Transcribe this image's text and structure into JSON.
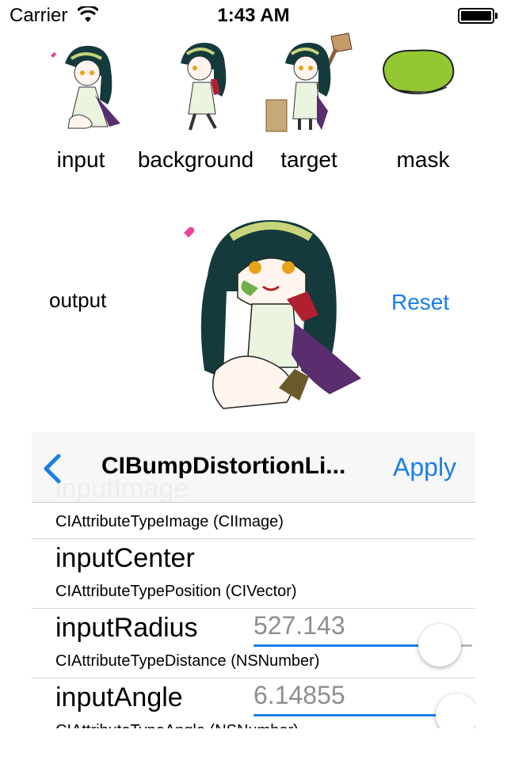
{
  "status_bar": {
    "carrier": "Carrier",
    "time": "1:43 AM",
    "battery_level": 1.0
  },
  "thumbnails": [
    {
      "label": "input",
      "icon": "chibi-girl-kneeling"
    },
    {
      "label": "background",
      "icon": "chibi-girl-walking"
    },
    {
      "label": "target",
      "icon": "chibi-girl-with-mallet"
    },
    {
      "label": "mask",
      "icon": "green-blob"
    }
  ],
  "output": {
    "label": "output",
    "reset_label": "Reset"
  },
  "navbar": {
    "back_icon": "chevron-left",
    "title": "CIBumpDistortionLi...",
    "apply_label": "Apply"
  },
  "parameters": [
    {
      "name": "inputImage",
      "type": "CIAttributeTypeImage (CIImage)"
    },
    {
      "name": "inputCenter",
      "type": "CIAttributeTypePosition (CIVector)"
    },
    {
      "name": "inputRadius",
      "type": "CIAttributeTypeDistance (NSNumber)",
      "value": "527.143",
      "slider_fraction": 0.85
    },
    {
      "name": "inputAngle",
      "type": "CIAttributeTypeAngle (NSNumber)",
      "value": "6.14855",
      "slider_fraction": 0.93
    }
  ],
  "colors": {
    "accent": "#1a7ee8",
    "hair": "#143a3c",
    "mask": "#94c833",
    "skirt": "#5a2d6e"
  }
}
